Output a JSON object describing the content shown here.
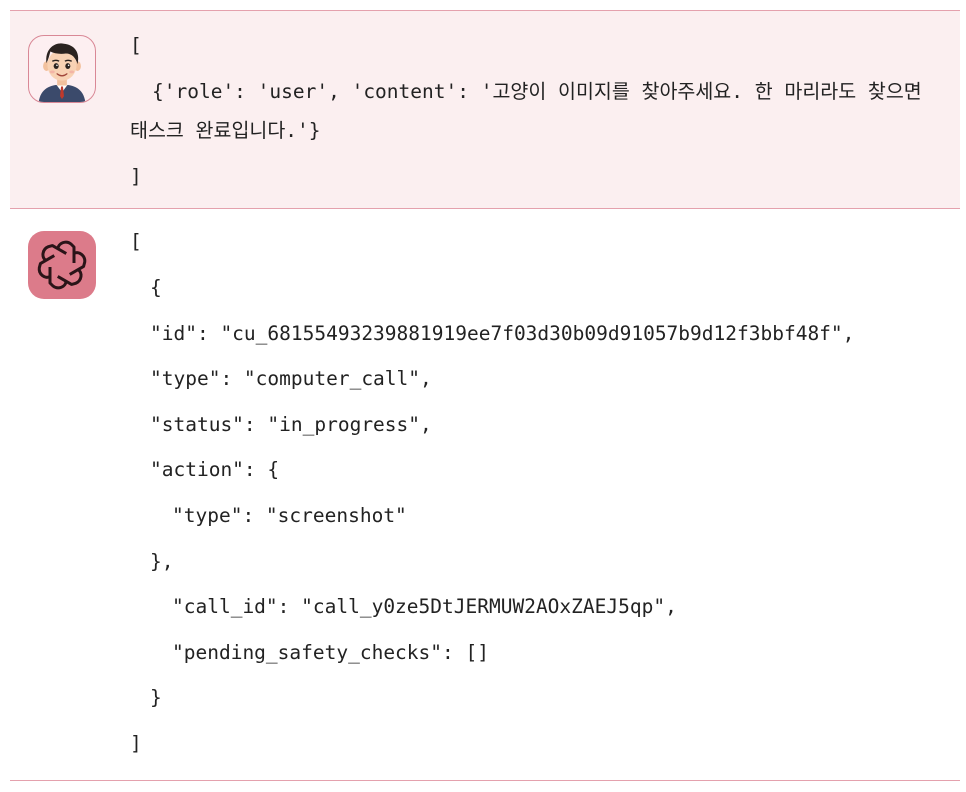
{
  "messages": [
    {
      "role_icon": "user-avatar-icon",
      "lines": [
        "[",
        "{'role': 'user', 'content': '고양이 이미지를 찾아주세요. 한 마리라도 찾으면",
        "태스크 완료입니다.'}",
        "]"
      ]
    },
    {
      "role_icon": "openai-logo-icon",
      "lines": [
        "[",
        "{",
        "\"id\": \"cu_68155493239881919ee7f03d30b09d91057b9d12f3bbf48f\",",
        "\"type\": \"computer_call\",",
        "\"status\": \"in_progress\",",
        "\"action\": {",
        "\"type\": \"screenshot\"",
        "},",
        "\"call_id\": \"call_y0ze5DtJERMUW2AOxZAEJ5qp\",",
        "\"pending_safety_checks\": []",
        "}",
        "]"
      ]
    }
  ],
  "colors": {
    "user_bg": "#fbeff0",
    "divider": "#e4a1ad",
    "bot_avatar_bg": "#dc7b8a"
  }
}
